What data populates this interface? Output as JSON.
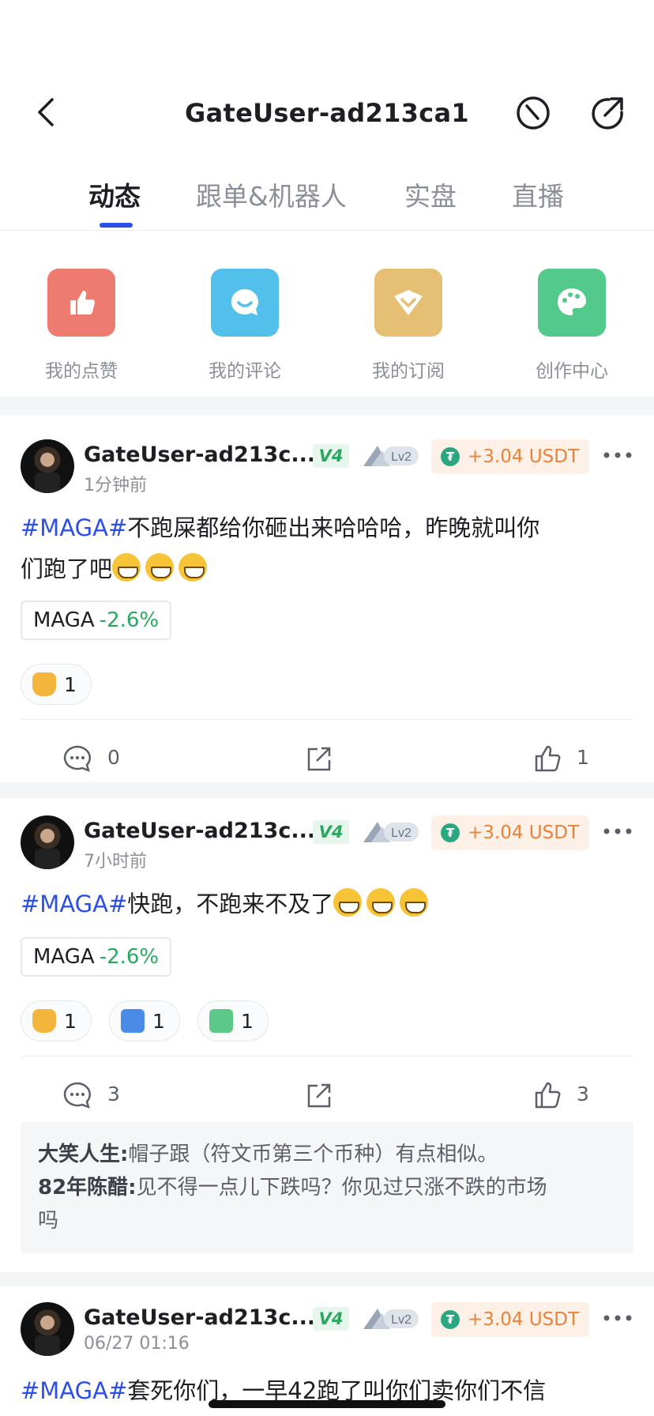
{
  "header": {
    "title": "GateUser-ad213ca1",
    "back_icon": "chevron-left-icon",
    "block_icon": "block-icon",
    "share_icon": "share-icon"
  },
  "tabs": [
    {
      "label": "动态",
      "active": true
    },
    {
      "label": "跟单&机器人",
      "active": false
    },
    {
      "label": "实盘",
      "active": false
    },
    {
      "label": "直播",
      "active": false
    }
  ],
  "quick_actions": [
    {
      "label": "我的点赞",
      "icon": "thumbs-up-icon",
      "color": "#ee7b6f"
    },
    {
      "label": "我的评论",
      "icon": "comment-icon",
      "color": "#53c0ec"
    },
    {
      "label": "我的订阅",
      "icon": "subscribe-icon",
      "color": "#e5bf73"
    },
    {
      "label": "创作中心",
      "icon": "palette-icon",
      "color": "#53c98b"
    }
  ],
  "posts": [
    {
      "username": "GateUser-ad213c...",
      "vip": "V4",
      "level": "Lv2",
      "reward": "+3.04 USDT",
      "time": "1分钟前",
      "hashtag": "#MAGA#",
      "text_line1": "不跑屎都给你砸出来哈哈哈，昨晚就叫你",
      "text_line2": "们跑了吧",
      "coin": {
        "name": "MAGA",
        "change": "-2.6%"
      },
      "reactions": [
        {
          "icon": "thumbs-up-emoji",
          "count": "1"
        }
      ],
      "comments_count": "0",
      "likes_count": "1"
    },
    {
      "username": "GateUser-ad213c...",
      "vip": "V4",
      "level": "Lv2",
      "reward": "+3.04 USDT",
      "time": "7小时前",
      "hashtag": "#MAGA#",
      "text_line1": "快跑，不跑来不及了",
      "coin": {
        "name": "MAGA",
        "change": "-2.6%"
      },
      "reactions": [
        {
          "icon": "thumbs-up-emoji",
          "count": "1"
        },
        {
          "icon": "hodl-emoji",
          "count": "1"
        },
        {
          "icon": "thinking-emoji",
          "count": "1"
        }
      ],
      "comments_count": "3",
      "likes_count": "3",
      "comments": [
        {
          "author": "大笑人生:",
          "text": "帽子跟（符文币第三个币种）有点相似。"
        },
        {
          "author": "82年陈醋:",
          "text": "见不得一点儿下跌吗？你见过只涨不跌的市场",
          "text2": "吗"
        }
      ]
    },
    {
      "username": "GateUser-ad213c...",
      "vip": "V4",
      "level": "Lv2",
      "reward": "+3.04 USDT",
      "time": "06/27 01:16",
      "hashtag": "#MAGA#",
      "text_line1": "套死你们，一早42跑了叫你们卖你们不信"
    }
  ]
}
